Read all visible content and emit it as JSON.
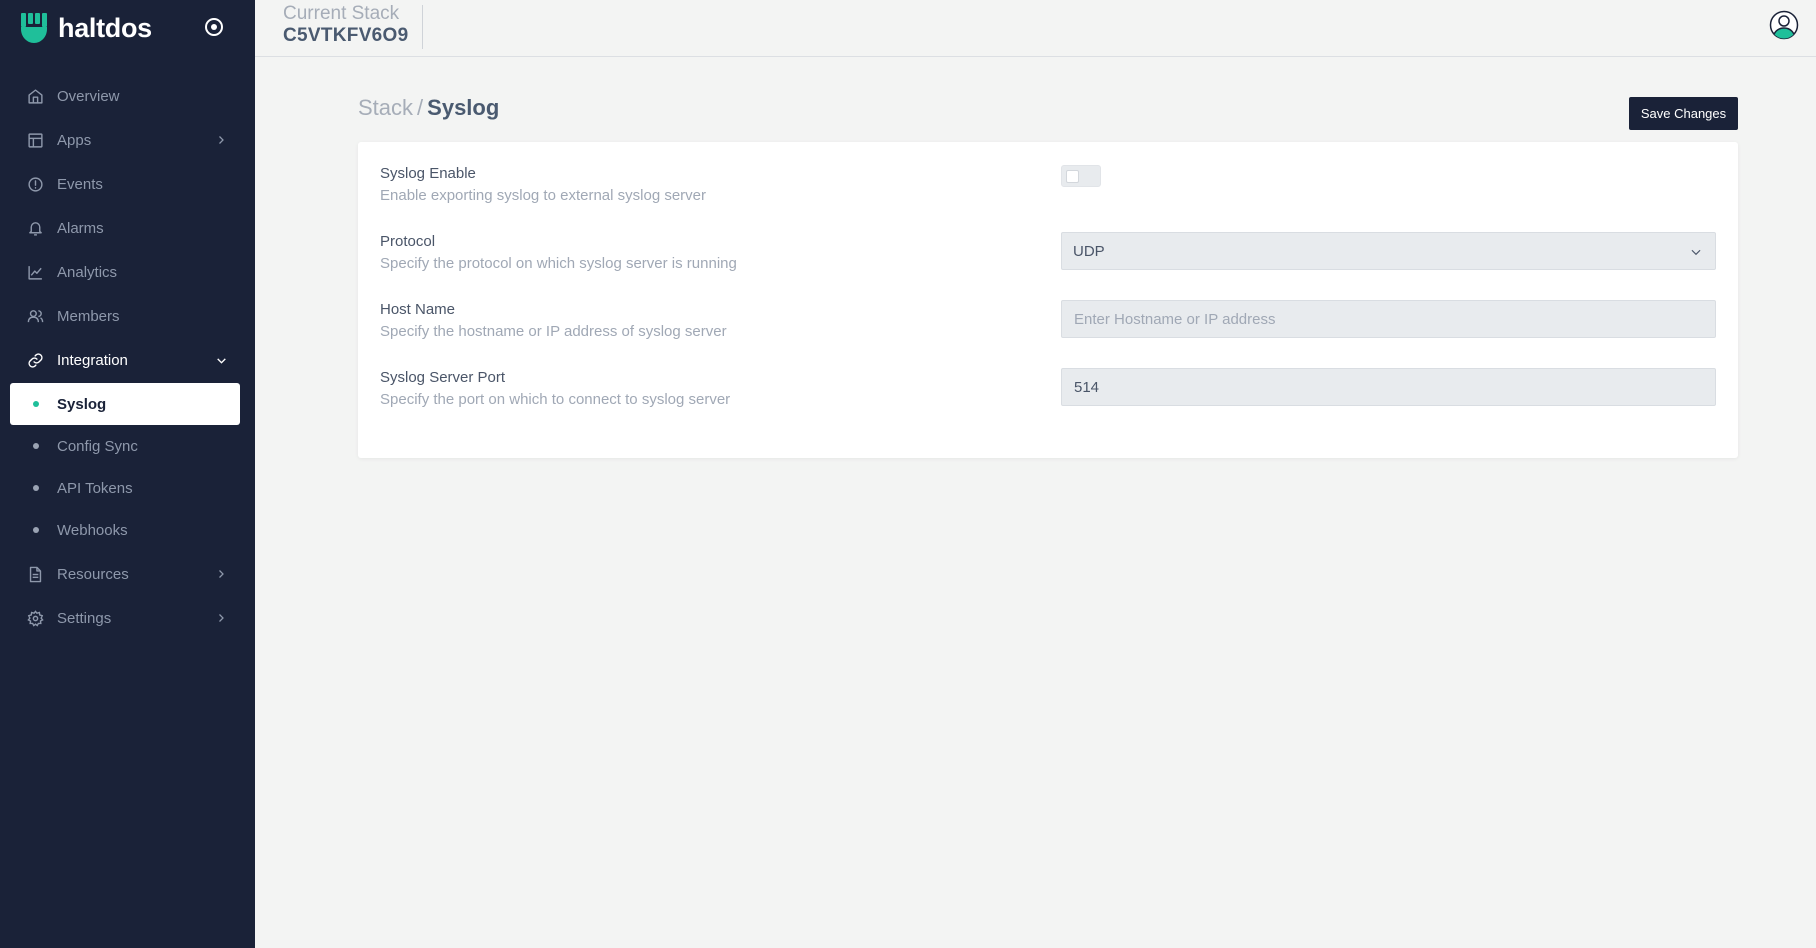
{
  "app": {
    "brand_name": "haltdos",
    "brand_color": "#1fbf9a",
    "sidebar_bg": "#1a2238"
  },
  "header": {
    "stack_label": "Current Stack",
    "stack_id": "C5VTKFV6O9"
  },
  "sidebar": {
    "items": [
      {
        "label": "Overview",
        "icon": "home-icon"
      },
      {
        "label": "Apps",
        "icon": "layout-icon",
        "chevron": "chevron-right-icon"
      },
      {
        "label": "Events",
        "icon": "alert-circle-icon"
      },
      {
        "label": "Alarms",
        "icon": "bell-icon"
      },
      {
        "label": "Analytics",
        "icon": "chart-line-icon"
      },
      {
        "label": "Members",
        "icon": "users-icon"
      },
      {
        "label": "Integration",
        "icon": "link-icon",
        "chevron": "chevron-down-icon",
        "expanded": true
      },
      {
        "label": "Resources",
        "icon": "file-text-icon",
        "chevron": "chevron-right-icon"
      },
      {
        "label": "Settings",
        "icon": "gear-icon",
        "chevron": "chevron-right-icon"
      }
    ],
    "sub_items": [
      {
        "label": "Syslog",
        "active": true
      },
      {
        "label": "Config Sync"
      },
      {
        "label": "API Tokens"
      },
      {
        "label": "Webhooks"
      }
    ]
  },
  "page": {
    "breadcrumb_parent": "Stack",
    "breadcrumb_sep": "/",
    "breadcrumb_current": "Syslog",
    "save_label": "Save Changes"
  },
  "form": {
    "syslog_enable": {
      "title": "Syslog Enable",
      "description": "Enable exporting syslog to external syslog server",
      "enabled": false
    },
    "protocol": {
      "title": "Protocol",
      "description": "Specify the protocol on which syslog server is running",
      "value": "UDP"
    },
    "host_name": {
      "title": "Host Name",
      "description": "Specify the hostname or IP address of syslog server",
      "value": "",
      "placeholder": "Enter Hostname or IP address"
    },
    "port": {
      "title": "Syslog Server Port",
      "description": "Specify the port on which to connect to syslog server",
      "value": "514"
    }
  }
}
